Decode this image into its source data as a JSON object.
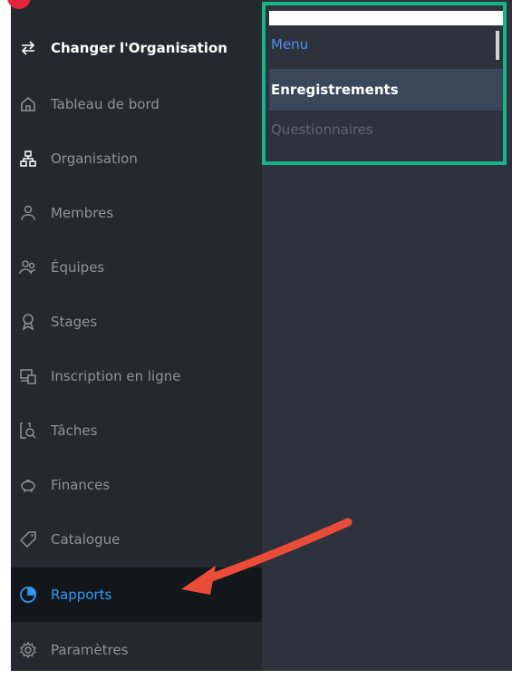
{
  "sidebar": {
    "items": [
      {
        "label": "Changer l'Organisation",
        "icon": "switch-arrows-icon"
      },
      {
        "label": "Tableau de bord",
        "icon": "home-icon"
      },
      {
        "label": "Organisation",
        "icon": "org-chart-icon"
      },
      {
        "label": "Membres",
        "icon": "person-icon"
      },
      {
        "label": "Équipes",
        "icon": "people-icon"
      },
      {
        "label": "Stages",
        "icon": "award-ribbon-icon"
      },
      {
        "label": "Inscription en ligne",
        "icon": "online-registration-icon"
      },
      {
        "label": "Tâches",
        "icon": "task-search-icon"
      },
      {
        "label": "Finances",
        "icon": "piggy-bank-icon"
      },
      {
        "label": "Catalogue",
        "icon": "tag-icon"
      },
      {
        "label": "Rapports",
        "icon": "pie-chart-icon"
      },
      {
        "label": "Paramètres",
        "icon": "gear-icon"
      }
    ]
  },
  "submenu": {
    "title": "Menu",
    "items": [
      {
        "label": "Enregistrements"
      },
      {
        "label": "Questionnaires"
      }
    ]
  },
  "colors": {
    "sidebar_bg": "#24282f",
    "selected_text": "#2f9bf0",
    "highlight_border": "#16b487",
    "arrow": "#ea4c3a"
  }
}
